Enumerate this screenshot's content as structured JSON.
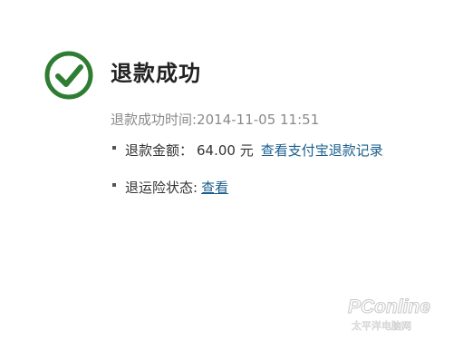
{
  "status": {
    "icon": "check-circle-icon",
    "color": "#2f7d32",
    "title": "退款成功"
  },
  "refund": {
    "time_label": "退款成功时间:",
    "time_value": "2014-11-05 11:51"
  },
  "amount": {
    "label": "退款金额：",
    "value": "64.00 元",
    "link": "查看支付宝退款记录"
  },
  "insurance": {
    "label": "退运险状态:",
    "link": "查看"
  },
  "watermark": {
    "brand": "PConline",
    "subtitle": "太平洋电脑网"
  },
  "colors": {
    "link": "#1a5e8c",
    "muted_text": "#8a8a8a"
  }
}
